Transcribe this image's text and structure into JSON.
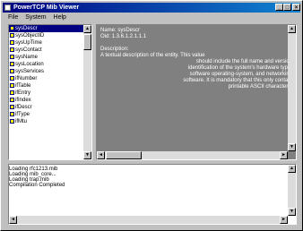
{
  "window": {
    "title": "PowerTCP Mib Viewer",
    "controls": {
      "minimize": "_",
      "maximize": "□",
      "close": "×"
    }
  },
  "menu": [
    "File",
    "System",
    "Help"
  ],
  "tree": {
    "items": [
      {
        "label": "sysDescr",
        "selected": true
      },
      {
        "label": "sysObjectID",
        "selected": false
      },
      {
        "label": "sysUpTime",
        "selected": false
      },
      {
        "label": "sysContact",
        "selected": false
      },
      {
        "label": "sysName",
        "selected": false
      },
      {
        "label": "sysLocation",
        "selected": false
      },
      {
        "label": "sysServices",
        "selected": false
      },
      {
        "label": "ifNumber",
        "selected": false
      },
      {
        "label": "ifTable",
        "selected": false
      },
      {
        "label": "ifEntry",
        "selected": false
      },
      {
        "label": "ifIndex",
        "selected": false
      },
      {
        "label": "ifDescr",
        "selected": false
      },
      {
        "label": "ifType",
        "selected": false
      },
      {
        "label": "ifMtu",
        "selected": false
      }
    ]
  },
  "detail": {
    "name_line": "Name: sysDescr",
    "oid_line": "Oid: 1.3.6.1.2.1.1.1",
    "desc_heading": "Description:",
    "desc_lines": [
      "A textual description of the entity.  This value",
      "should include the full name and version",
      "identification of the system's hardware type,",
      "software operating-system, and networking",
      "software.  It is mandatory that this only contain",
      "printable ASCII characters."
    ]
  },
  "log": {
    "lines": [
      "Loading rfc1213.mib",
      "Loading mib_core...",
      "Loading trap.mib",
      "Compilation Completed"
    ]
  },
  "icons": {
    "tree_item": "mib-node-icon",
    "app": "app-icon",
    "scroll_up": "▲",
    "scroll_down": "▼",
    "scroll_left": "◄",
    "scroll_right": "►"
  }
}
